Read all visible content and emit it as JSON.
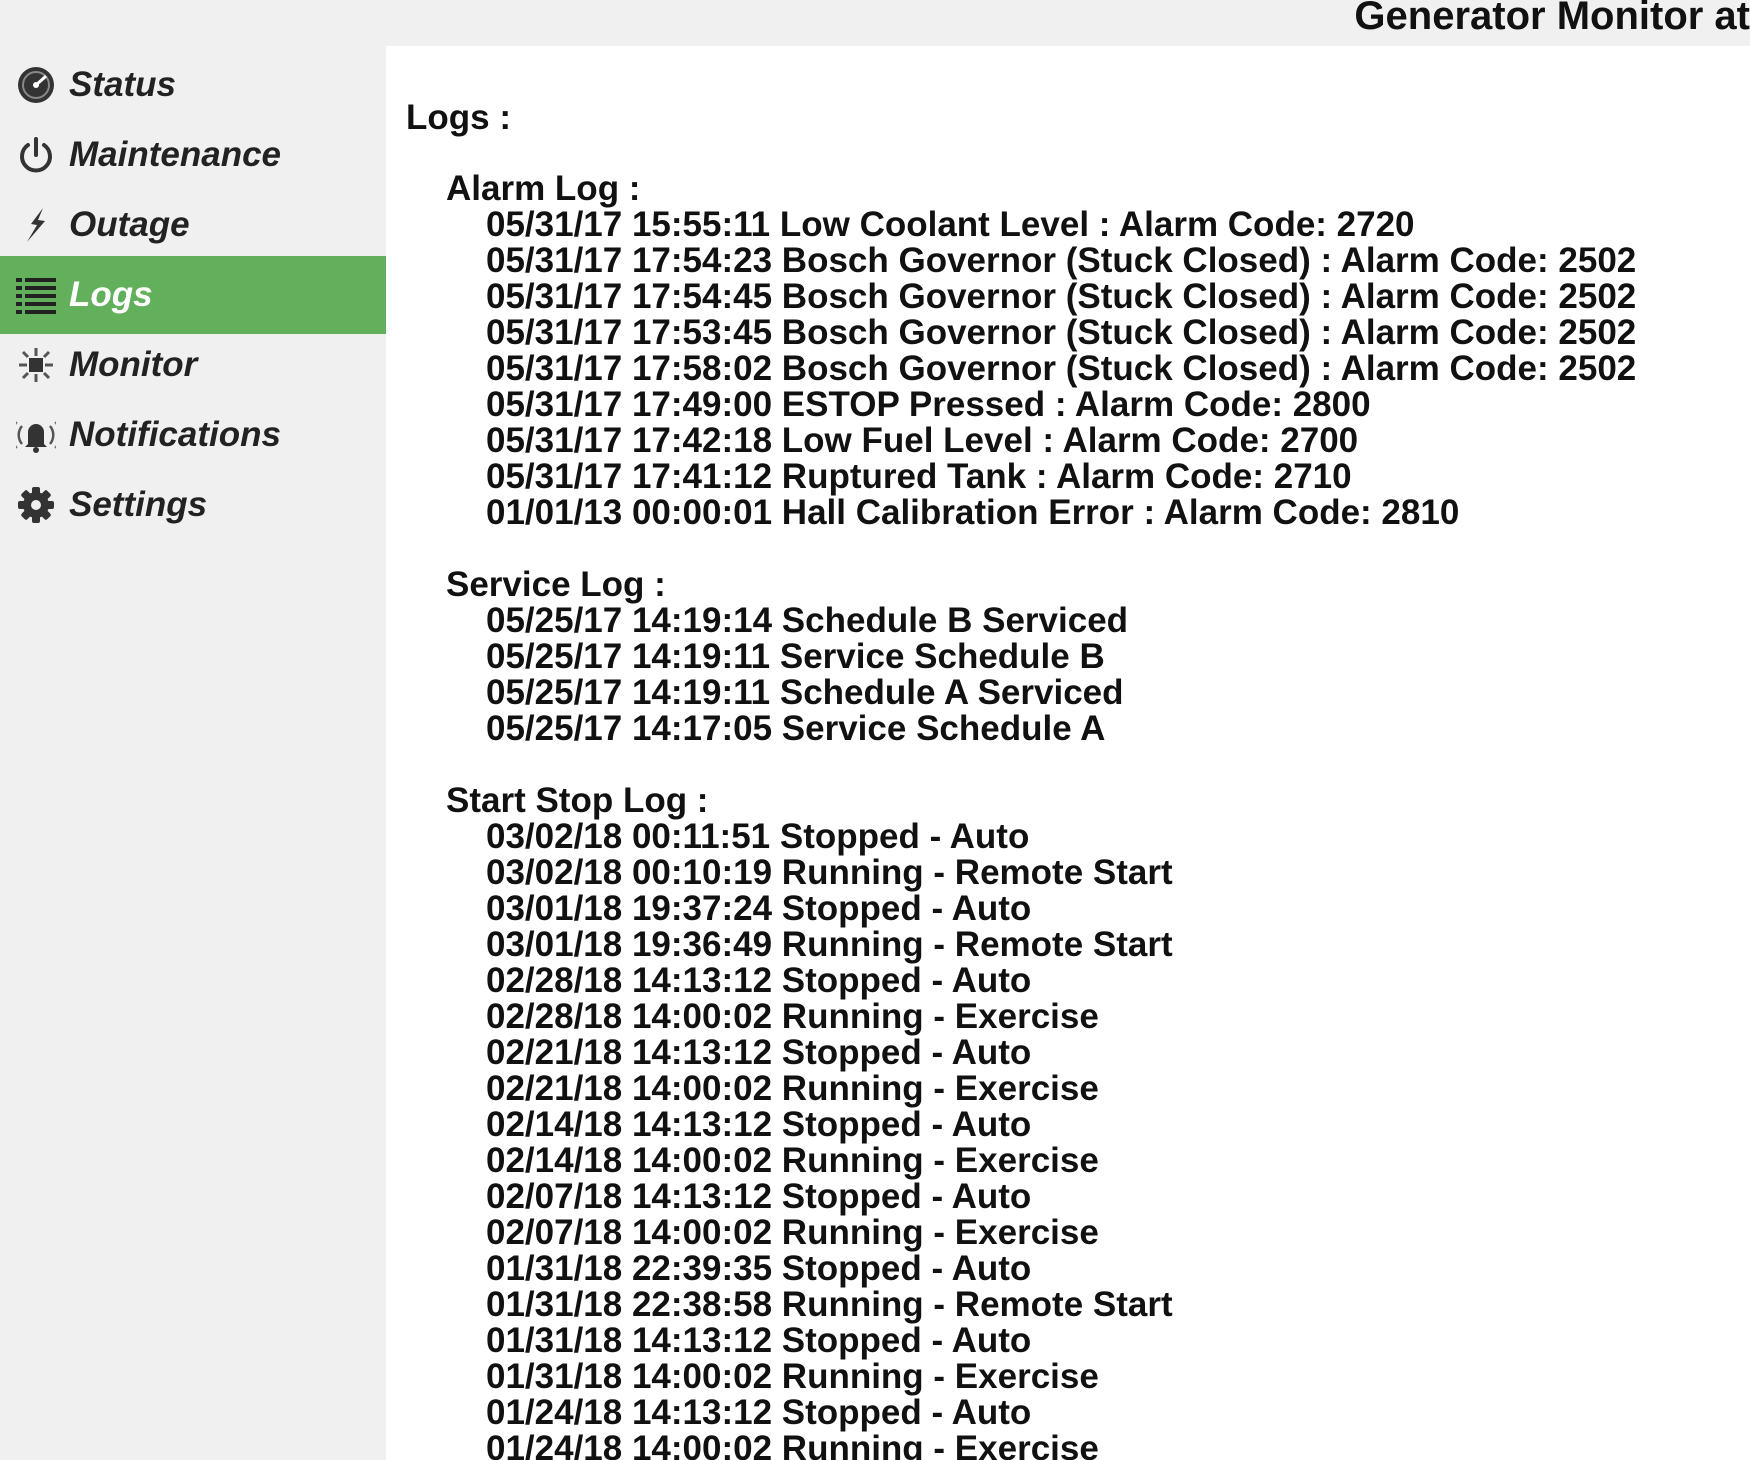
{
  "header": {
    "title": "Generator Monitor at"
  },
  "sidebar": {
    "active_color": "#62b05c",
    "items": [
      {
        "label": "Status",
        "icon": "gauge-icon"
      },
      {
        "label": "Maintenance",
        "icon": "power-icon"
      },
      {
        "label": "Outage",
        "icon": "lightning-icon"
      },
      {
        "label": "Logs",
        "icon": "list-icon",
        "active": true
      },
      {
        "label": "Monitor",
        "icon": "monitor-icon"
      },
      {
        "label": "Notifications",
        "icon": "bell-icon"
      },
      {
        "label": "Settings",
        "icon": "gear-icon"
      }
    ]
  },
  "main": {
    "title": "Logs :",
    "alarm_log": {
      "title": "Alarm Log :",
      "entries": [
        "05/31/17 15:55:11 Low Coolant Level : Alarm Code: 2720",
        "05/31/17 17:54:23 Bosch Governor (Stuck Closed) : Alarm Code: 2502",
        "05/31/17 17:54:45 Bosch Governor (Stuck Closed) : Alarm Code: 2502",
        "05/31/17 17:53:45 Bosch Governor (Stuck Closed) : Alarm Code: 2502",
        "05/31/17 17:58:02 Bosch Governor (Stuck Closed) : Alarm Code: 2502",
        "05/31/17 17:49:00 ESTOP Pressed : Alarm Code: 2800",
        "05/31/17 17:42:18 Low Fuel Level : Alarm Code: 2700",
        "05/31/17 17:41:12 Ruptured Tank : Alarm Code: 2710",
        "01/01/13 00:00:01 Hall Calibration Error : Alarm Code: 2810"
      ]
    },
    "service_log": {
      "title": "Service Log :",
      "entries": [
        "05/25/17 14:19:14 Schedule B Serviced",
        "05/25/17 14:19:11 Service Schedule B",
        "05/25/17 14:19:11 Schedule A Serviced",
        "05/25/17 14:17:05 Service Schedule A"
      ]
    },
    "start_stop_log": {
      "title": "Start Stop Log :",
      "entries": [
        "03/02/18 00:11:51 Stopped - Auto",
        "03/02/18 00:10:19 Running - Remote Start",
        "03/01/18 19:37:24 Stopped - Auto",
        "03/01/18 19:36:49 Running - Remote Start",
        "02/28/18 14:13:12 Stopped - Auto",
        "02/28/18 14:00:02 Running - Exercise",
        "02/21/18 14:13:12 Stopped - Auto",
        "02/21/18 14:00:02 Running - Exercise",
        "02/14/18 14:13:12 Stopped - Auto",
        "02/14/18 14:00:02 Running - Exercise",
        "02/07/18 14:13:12 Stopped - Auto",
        "02/07/18 14:00:02 Running - Exercise",
        "01/31/18 22:39:35 Stopped - Auto",
        "01/31/18 22:38:58 Running - Remote Start",
        "01/31/18 14:13:12 Stopped - Auto",
        "01/31/18 14:00:02 Running - Exercise",
        "01/24/18 14:13:12 Stopped - Auto",
        "01/24/18 14:00:02 Running - Exercise"
      ]
    }
  }
}
